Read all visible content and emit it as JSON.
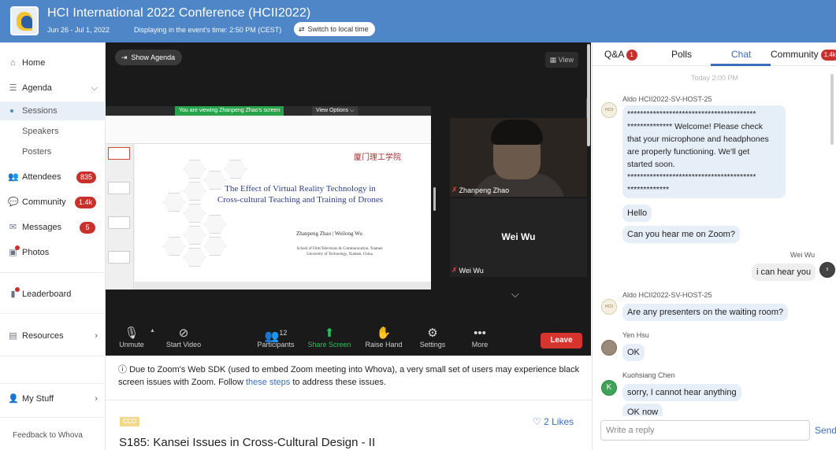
{
  "header": {
    "title": "HCI International 2022 Conference (HCII2022)",
    "dates": "Jun 26 - Jul 1, 2022",
    "timezone_text": "Displaying in the event's time: 2:50 PM (CEST)",
    "switch_label": "Switch to local time",
    "color": "#4e86c8"
  },
  "sidebar": {
    "home": "Home",
    "agenda": "Agenda",
    "sessions": "Sessions",
    "speakers": "Speakers",
    "posters": "Posters",
    "attendees": "Attendees",
    "attendees_count": "835",
    "community": "Community",
    "community_count": "1.4k",
    "messages": "Messages",
    "messages_count": "5",
    "photos": "Photos",
    "leaderboard": "Leaderboard",
    "resources": "Resources",
    "my_stuff": "My Stuff",
    "feedback": "Feedback to Whova"
  },
  "zoom": {
    "show_agenda": "Show Agenda",
    "view": "View",
    "viewing_banner": "You are viewing Zhanpeng Zhao's screen",
    "view_options": "View Options",
    "slide": {
      "university": "厦门理工学院",
      "title_line1": "The Effect of Virtual Reality Technology in",
      "title_line2": "Cross-cultural Teaching and Training of Drones",
      "authors": "Zhanpeng Zhao | Weilong Wu",
      "affiliation_line1": "School of Film/Television & Communication, Xiamen",
      "affiliation_line2": "University of Technology, Xiamen, China"
    },
    "tiles": [
      {
        "name": "Zhanpeng Zhao"
      },
      {
        "name": "Wei Wu",
        "big_name": "Wei Wu"
      }
    ],
    "toolbar": {
      "unmute": "Unmute",
      "start_video": "Start Video",
      "participants": "Participants",
      "participants_count": "12",
      "share_screen": "Share Screen",
      "raise_hand": "Raise Hand",
      "settings": "Settings",
      "more": "More",
      "leave": "Leave"
    }
  },
  "notice": {
    "text_before": "Due to Zoom's Web SDK (used to embed Zoom meeting into Whova), a very small set of users may experience black screen issues with Zoom. Follow ",
    "link": "these steps",
    "text_after": " to address these issues."
  },
  "session": {
    "tag": "CCD",
    "likes": "2 Likes",
    "title": "S185: Kansei Issues in Cross-Cultural Design - II"
  },
  "chat": {
    "tabs": {
      "qa": "Q&A",
      "qa_count": "1",
      "polls": "Polls",
      "chat": "Chat",
      "community": "Community",
      "community_count": "1.4k"
    },
    "daystamp": "Today 2:00 PM",
    "messages": [
      {
        "sender": "Aldo HCII2022-SV-HOST-25",
        "text_lines": [
          "****************************************",
          "************** Welcome! Please check",
          "that your microphone and headphones",
          "are properly functioning. We'll get",
          "started soon.",
          "****************************************",
          "*************"
        ]
      },
      {
        "text": "Hello"
      },
      {
        "text": "Can you hear me on Zoom?"
      },
      {
        "sender": "Wei Wu",
        "text": "i can hear you"
      },
      {
        "sender": "Aldo HCII2022-SV-HOST-25",
        "text": "Are any presenters on the waiting room?"
      },
      {
        "sender": "Yen Hsu",
        "text": "OK"
      },
      {
        "sender": "Kuohsiang Chen",
        "text": "sorry, I cannot hear anything"
      },
      {
        "text": "OK now"
      }
    ],
    "reply_placeholder": "Write a reply",
    "send": "Send"
  }
}
